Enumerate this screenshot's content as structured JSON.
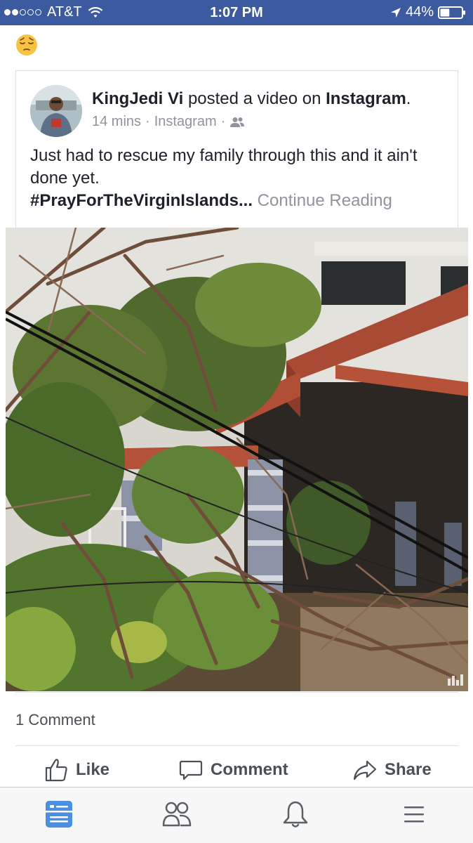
{
  "status_bar": {
    "carrier": "AT&T",
    "time": "1:07 PM",
    "battery": "44%",
    "signal_bars_filled": 2,
    "signal_bars_total": 5,
    "battery_level": 0.44
  },
  "status_emoji": "😔",
  "post": {
    "author": "KingJedi Vi",
    "action": "posted a video on",
    "platform": "Instagram",
    "headline_end": ".",
    "time_ago": "14 mins",
    "separator": "·",
    "source": "Instagram",
    "audience_icon": "friends-icon",
    "text_line": "Just had to rescue my family through this and it ain't done yet.",
    "hashtag": "#PrayForTheVirginIslands...",
    "continue_label": "Continue Reading",
    "video_icon": "instagram-watermark-icon"
  },
  "engagement": {
    "comments": "1 Comment"
  },
  "actions": {
    "like": "Like",
    "comment": "Comment",
    "share": "Share"
  },
  "tabbar": {
    "items": [
      "news-feed-icon",
      "friends-icon",
      "notifications-bell-icon",
      "menu-icon"
    ],
    "active": "news-feed-icon"
  },
  "colors": {
    "brand_blue": "#3b5aa0",
    "tab_active": "#4a90e2",
    "text_secondary": "#90949c"
  }
}
